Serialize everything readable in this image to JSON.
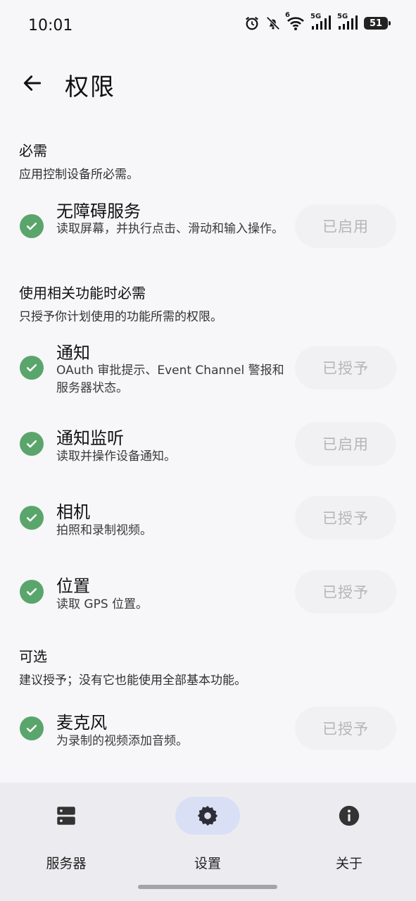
{
  "status_bar": {
    "time": "10:01",
    "battery": "51",
    "icons": [
      "alarm-icon",
      "bell-off-icon",
      "wifi-6-icon",
      "signal-5g-icon",
      "signal-5g-icon",
      "battery-icon"
    ],
    "network_labels": {
      "wifi": "6",
      "sim1": "5G",
      "sim2": "5G"
    }
  },
  "app_bar": {
    "title": "权限",
    "back_icon": "arrow-back-icon"
  },
  "sections": {
    "required": {
      "title": "必需",
      "description": "应用控制设备所必需。"
    },
    "feature": {
      "title": "使用相关功能时必需",
      "description": "只授予你计划使用的功能所需的权限。"
    },
    "optional": {
      "title": "可选",
      "description": "建议授予；没有它也能使用全部基本功能。"
    }
  },
  "permissions": {
    "accessibility": {
      "name": "无障碍服务",
      "description": "读取屏幕，并执行点击、滑动和输入操作。",
      "button": "已启用"
    },
    "notifications": {
      "name": "通知",
      "description": "OAuth 审批提示、Event Channel 警报和服务器状态。",
      "button": "已授予"
    },
    "notification_listener": {
      "name": "通知监听",
      "description": "读取并操作设备通知。",
      "button": "已启用"
    },
    "camera": {
      "name": "相机",
      "description": "拍照和录制视频。",
      "button": "已授予"
    },
    "location": {
      "name": "位置",
      "description": "读取 GPS 位置。",
      "button": "已授予"
    },
    "microphone": {
      "name": "麦克风",
      "description": "为录制的视频添加音频。",
      "button": "已授予"
    }
  },
  "bottom_nav": {
    "items": [
      {
        "label": "服务器",
        "icon": "server-icon",
        "active": false
      },
      {
        "label": "设置",
        "icon": "gear-icon",
        "active": true
      },
      {
        "label": "关于",
        "icon": "info-icon",
        "active": false
      }
    ]
  },
  "colors": {
    "background": "#f7f7fa",
    "check_green": "#5aa56b",
    "button_bg": "#f1f1f4",
    "button_text": "#b5b5b8",
    "nav_bg": "#ececf0",
    "nav_active_pill": "#d9e0f5"
  }
}
